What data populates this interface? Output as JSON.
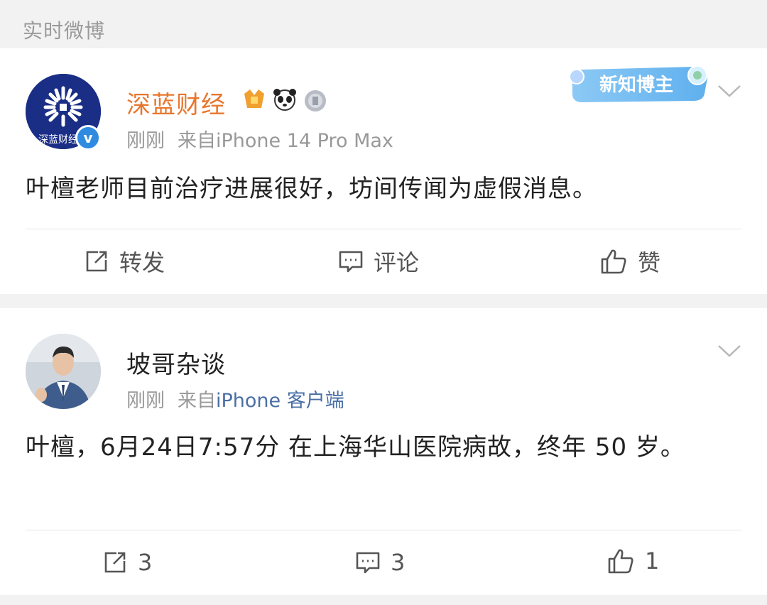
{
  "header": {
    "title": "实时微博"
  },
  "posts": [
    {
      "username": "深蓝财经",
      "avatar_text": "深蓝财经",
      "time": "刚刚",
      "source_prefix": "来自",
      "source_client": "iPhone 14 Pro Max",
      "badge_label": "新知博主",
      "text": "叶檀老师目前治疗进展很好，坊间传闻为虚假消息。",
      "actions": {
        "repost": "转发",
        "comment": "评论",
        "like": "赞"
      },
      "username_color": "#e8762d"
    },
    {
      "username": "坡哥杂谈",
      "time": "刚刚",
      "source_prefix": "来自",
      "source_client": "iPhone 客户端",
      "text": "叶檀，6月24日7:57分 在上海华山医院病故，终年 50 岁。",
      "actions": {
        "repost": "3",
        "comment": "3",
        "like": "1"
      }
    }
  ],
  "icons": [
    "repost-icon",
    "comment-icon",
    "like-icon",
    "chevron-down-icon",
    "verified-icon"
  ]
}
